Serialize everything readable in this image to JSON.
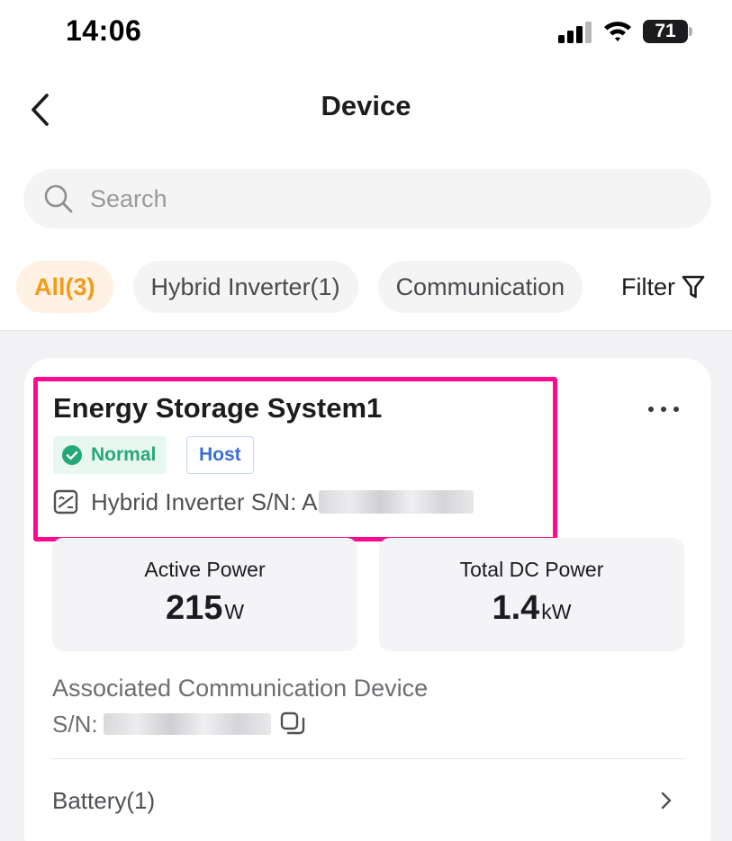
{
  "status_bar": {
    "time": "14:06",
    "battery_level": "71"
  },
  "header": {
    "title": "Device"
  },
  "search": {
    "placeholder": "Search"
  },
  "chips": [
    {
      "label": "All(3)",
      "active": true
    },
    {
      "label": "Hybrid Inverter(1)",
      "active": false
    },
    {
      "label": "Communication",
      "active": false
    }
  ],
  "filter": {
    "label": "Filter"
  },
  "device_card": {
    "name": "Energy Storage System1",
    "status_badge": "Normal",
    "role_badge": "Host",
    "sn_label": "Hybrid Inverter S/N: A",
    "stats": [
      {
        "label": "Active Power",
        "value": "215",
        "unit": "W"
      },
      {
        "label": "Total DC Power",
        "value": "1.4",
        "unit": "kW"
      }
    ],
    "associated_title": "Associated Communication Device",
    "associated_sn_label": "S/N:",
    "battery_label": "Battery(1)"
  },
  "colors": {
    "accent_orange": "#f39b1b",
    "status_green": "#25a97a",
    "host_blue": "#3a6fd8",
    "highlight_pink": "#ff0a8f"
  }
}
